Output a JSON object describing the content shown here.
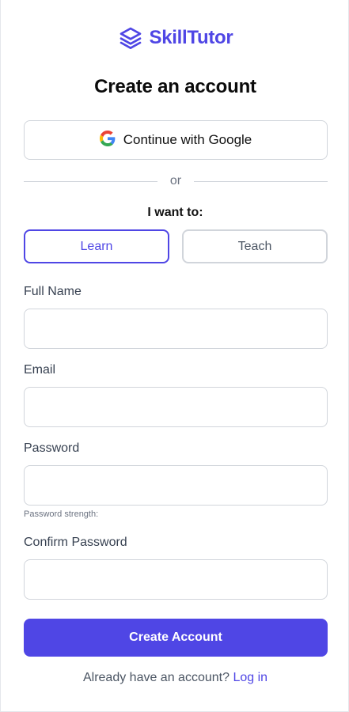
{
  "brand": {
    "name": "SkillTutor",
    "icon": "layers-icon",
    "color": "#4f46e5"
  },
  "title": "Create an account",
  "google": {
    "label": "Continue with Google",
    "icon": "google-icon"
  },
  "divider_text": "or",
  "role": {
    "prompt": "I want to:",
    "learn_label": "Learn",
    "teach_label": "Teach",
    "selected": "Learn"
  },
  "fields": {
    "full_name": {
      "label": "Full Name",
      "value": "",
      "placeholder": ""
    },
    "email": {
      "label": "Email",
      "value": "",
      "placeholder": ""
    },
    "password": {
      "label": "Password",
      "value": "",
      "placeholder": "",
      "strength_label": "Password strength:"
    },
    "confirm_password": {
      "label": "Confirm Password",
      "value": "",
      "placeholder": ""
    }
  },
  "submit_label": "Create Account",
  "login": {
    "prompt": "Already have an account?",
    "link_label": "Log in"
  },
  "colors": {
    "primary": "#4f46e5",
    "border": "#d1d5db",
    "text": "#374151"
  }
}
